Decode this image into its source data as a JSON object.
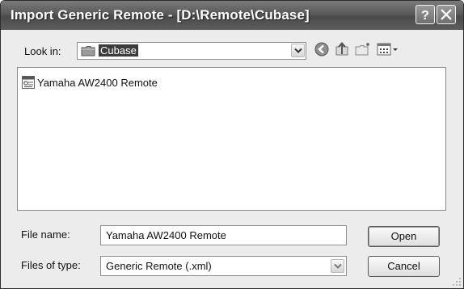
{
  "window": {
    "title": "Import Generic Remote - [D:\\Remote\\Cubase]"
  },
  "titlebar_buttons": {
    "help": "?",
    "close": "X"
  },
  "lookin": {
    "label": "Look in:",
    "value": "Cubase"
  },
  "toolbar_icons": [
    "back-icon",
    "up-folder-icon",
    "new-folder-icon",
    "view-menu-icon"
  ],
  "files": [
    {
      "name": "Yamaha AW2400 Remote",
      "icon": "xml-file-icon"
    }
  ],
  "filename": {
    "label": "File name:",
    "value": "Yamaha AW2400 Remote"
  },
  "filetype": {
    "label": "Files of type:",
    "value": "Generic Remote (.xml)"
  },
  "buttons": {
    "open": "Open",
    "cancel": "Cancel"
  }
}
